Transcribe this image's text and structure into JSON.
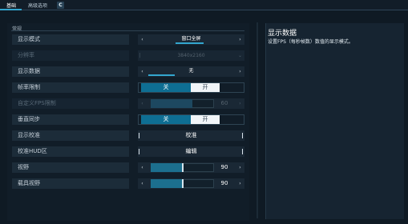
{
  "tabs": [
    {
      "label": "基础",
      "active": true
    },
    {
      "label": "高级选项",
      "active": false
    },
    {
      "label": "C",
      "active": false
    }
  ],
  "section": {
    "title": "常规"
  },
  "settings": [
    {
      "label": "显示模式",
      "type": "selector",
      "value": "窗口全屏",
      "disabled": false
    },
    {
      "label": "分辨率",
      "type": "dropdown",
      "value": "3840x2160",
      "disabled": true
    },
    {
      "label": "显示数据",
      "type": "selector",
      "value": "无",
      "disabled": false
    },
    {
      "label": "帧率限制",
      "type": "toggle",
      "on_label": "关",
      "off_label": "开",
      "selected": "关",
      "disabled": false
    },
    {
      "label": "自定义FPS限制",
      "type": "slider",
      "value": "60",
      "fill": 0.55,
      "disabled": true
    },
    {
      "label": "垂直同步",
      "type": "toggle",
      "on_label": "关",
      "off_label": "开",
      "selected": "关",
      "disabled": false
    },
    {
      "label": "显示校准",
      "type": "button",
      "value": "校准",
      "disabled": false
    },
    {
      "label": "校准HUD区",
      "type": "button",
      "value": "编辑",
      "disabled": false
    },
    {
      "label": "视野",
      "type": "slider",
      "value": "90",
      "fill": 0.5,
      "disabled": false
    },
    {
      "label": "载具视野",
      "type": "slider",
      "value": "90",
      "fill": 0.5,
      "disabled": false
    }
  ],
  "description": {
    "title": "显示数据",
    "text": "设置FPS（每秒帧数）数值的显示模式。"
  },
  "colors": {
    "accent": "#33a6cf",
    "toggle_active": "#0e6e93",
    "background": "#0f1a24"
  }
}
